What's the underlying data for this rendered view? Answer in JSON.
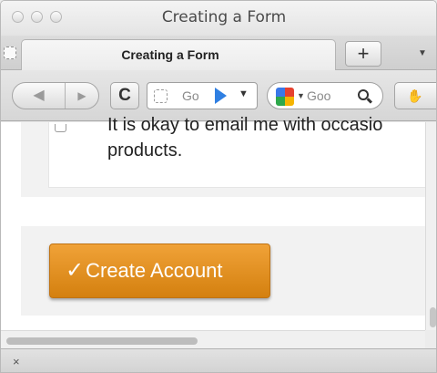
{
  "window": {
    "title": "Creating a Form"
  },
  "tabs": {
    "active_label": "Creating a Form",
    "new_tab_label": "+",
    "list_label": "▼"
  },
  "nav": {
    "reload_label": "C",
    "url_text": "Go",
    "url_dropdown": "▼",
    "search_text": "Goo",
    "search_dropdown": "▼",
    "extension_label": "✋"
  },
  "form": {
    "checkbox_label_line1": "It is okay to email me with occasio",
    "checkbox_label_line2": "products.",
    "submit_button_label": "Create Account",
    "submit_icon": "✓"
  },
  "addon_bar": {
    "close_label": "×"
  },
  "colors": {
    "button_orange": "#e69426",
    "google_blue": "#3a78e8",
    "google_red": "#e6412f",
    "google_yellow": "#f5b400",
    "google_green": "#2ea84b"
  }
}
